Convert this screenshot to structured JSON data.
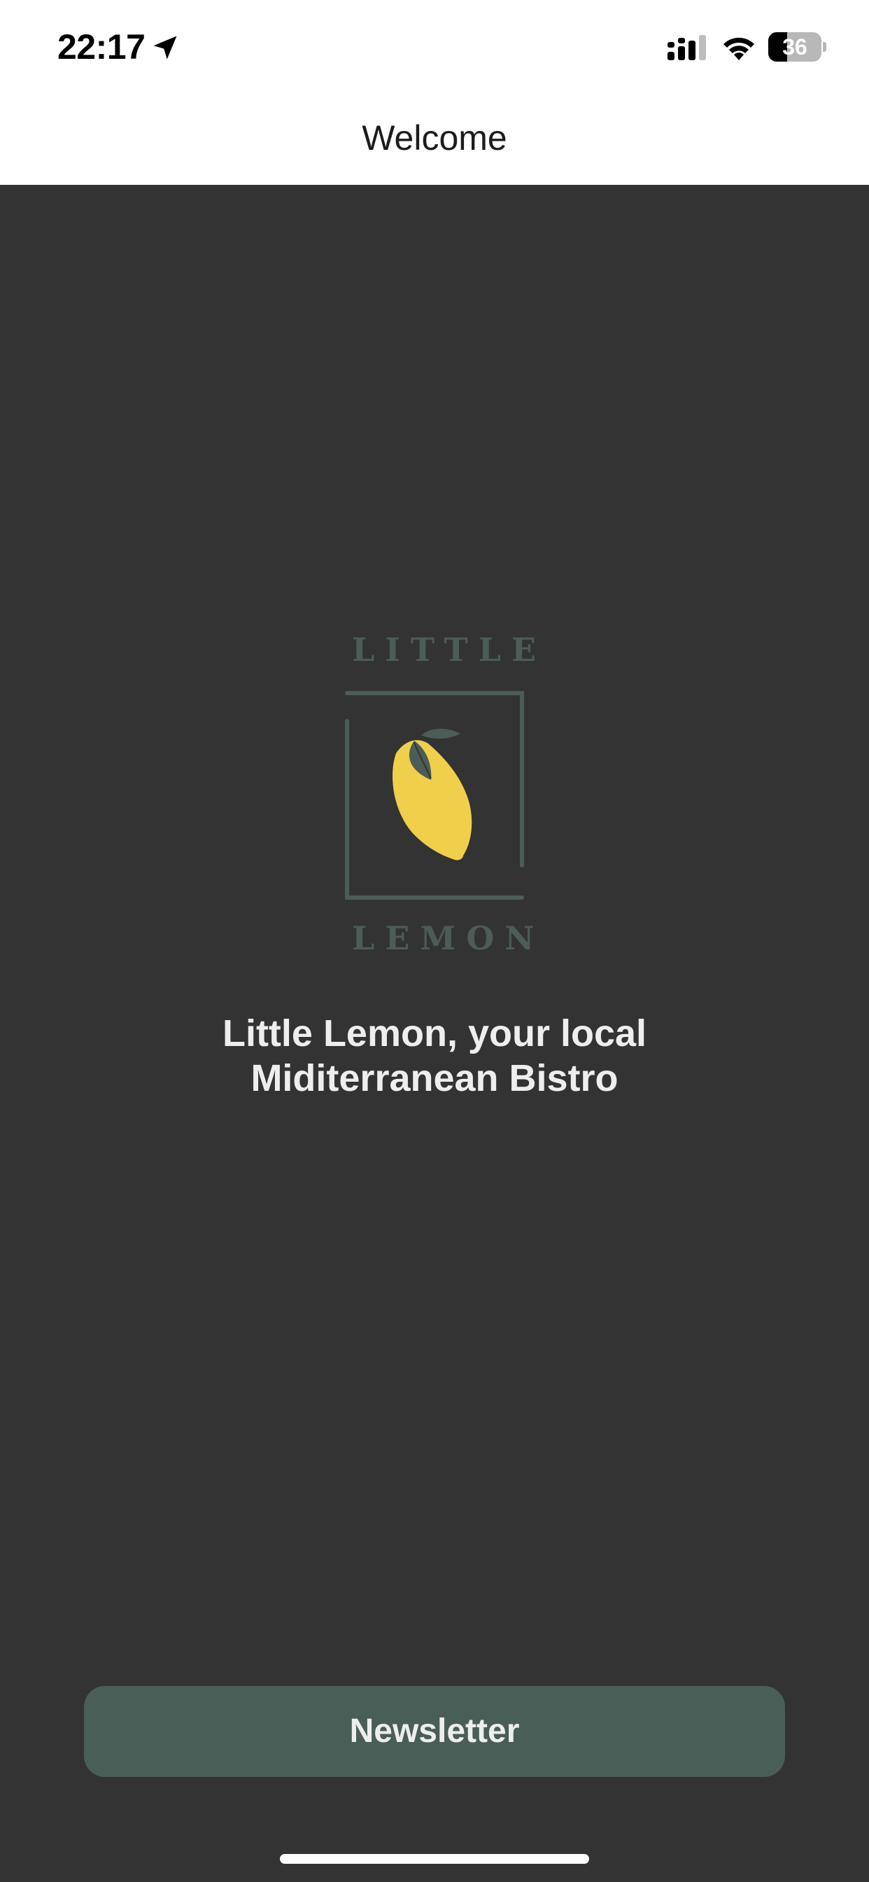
{
  "status_bar": {
    "time": "22:17",
    "battery_level": "36",
    "battery_fraction": 0.36,
    "icons": [
      "location-arrow-icon",
      "cellular-signal-icon",
      "wifi-icon",
      "battery-icon"
    ]
  },
  "header": {
    "title": "Welcome"
  },
  "logo": {
    "top_word": "LITTLE",
    "bottom_word": "LEMON",
    "icon": "lemon-icon",
    "frame_color": "#4c5c57",
    "lemon_color": "#f0cf4a",
    "leaf_color": "#4c5c57"
  },
  "main": {
    "tagline_line1": "Little Lemon, your local",
    "tagline_line2": "Miditerranean Bistro"
  },
  "actions": {
    "newsletter_label": "Newsletter"
  },
  "colors": {
    "background": "#333333",
    "header_background": "#ffffff",
    "button_background": "#495e57",
    "text_light": "#eeeeee"
  }
}
